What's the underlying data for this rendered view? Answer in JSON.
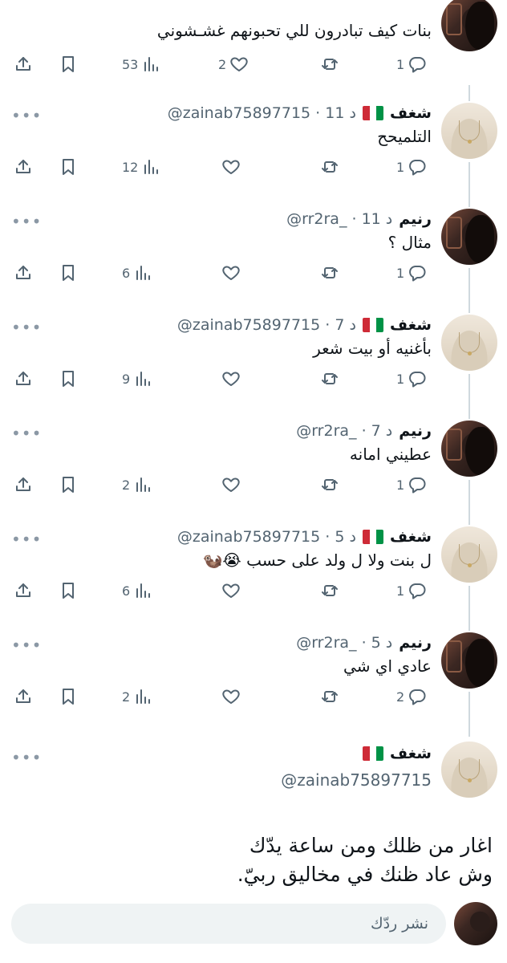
{
  "flag_colors": [
    "#009246",
    "#ffffff",
    "#ce2b37"
  ],
  "icons": {
    "share": "share-icon",
    "bookmark": "bookmark-icon",
    "views": "views-icon",
    "like": "heart-icon",
    "retweet": "retweet-icon",
    "reply": "reply-icon",
    "more": "more-icon"
  },
  "tweets": [
    {
      "name": "",
      "handle": "",
      "time": "",
      "text": "بنات كيف تبادرون للي تحبونهم غشـشوني",
      "views": "53",
      "likes": "2",
      "retweets": "",
      "replies": "1"
    },
    {
      "name": "شغف",
      "handle": "@zainab75897715",
      "time": "11 د",
      "text": "التلميحح",
      "views": "12",
      "likes": "",
      "retweets": "",
      "replies": "1"
    },
    {
      "name": "رنيم",
      "handle": "@rr2ra_",
      "time": "11 د",
      "text": "مثال ؟",
      "views": "6",
      "likes": "",
      "retweets": "",
      "replies": "1"
    },
    {
      "name": "شغف",
      "handle": "@zainab75897715",
      "time": "7 د",
      "text": "بأغنيه أو بيت شعر",
      "views": "9",
      "likes": "",
      "retweets": "",
      "replies": "1"
    },
    {
      "name": "رنيم",
      "handle": "@rr2ra_",
      "time": "7 د",
      "text": "عطيني امانه",
      "views": "2",
      "likes": "",
      "retweets": "",
      "replies": "1"
    },
    {
      "name": "شغف",
      "handle": "@zainab75897715",
      "time": "5 د",
      "text": "ل بنت ولا ل ولد على حسب 😭🦦",
      "views": "6",
      "likes": "",
      "retweets": "",
      "replies": "1"
    },
    {
      "name": "رنيم",
      "handle": "@rr2ra_",
      "time": "5 د",
      "text": "عادي اي شي",
      "views": "2",
      "likes": "",
      "retweets": "",
      "replies": "2"
    }
  ],
  "main_tweet": {
    "name": "شغف",
    "handle": "@zainab75897715",
    "line1": "اغار من ظلك ومن ساعة يدّك",
    "line2": "وش عاد ظنك في مخاليق ربيّ."
  },
  "reply_bar": {
    "placeholder": "نشر ردّك"
  }
}
